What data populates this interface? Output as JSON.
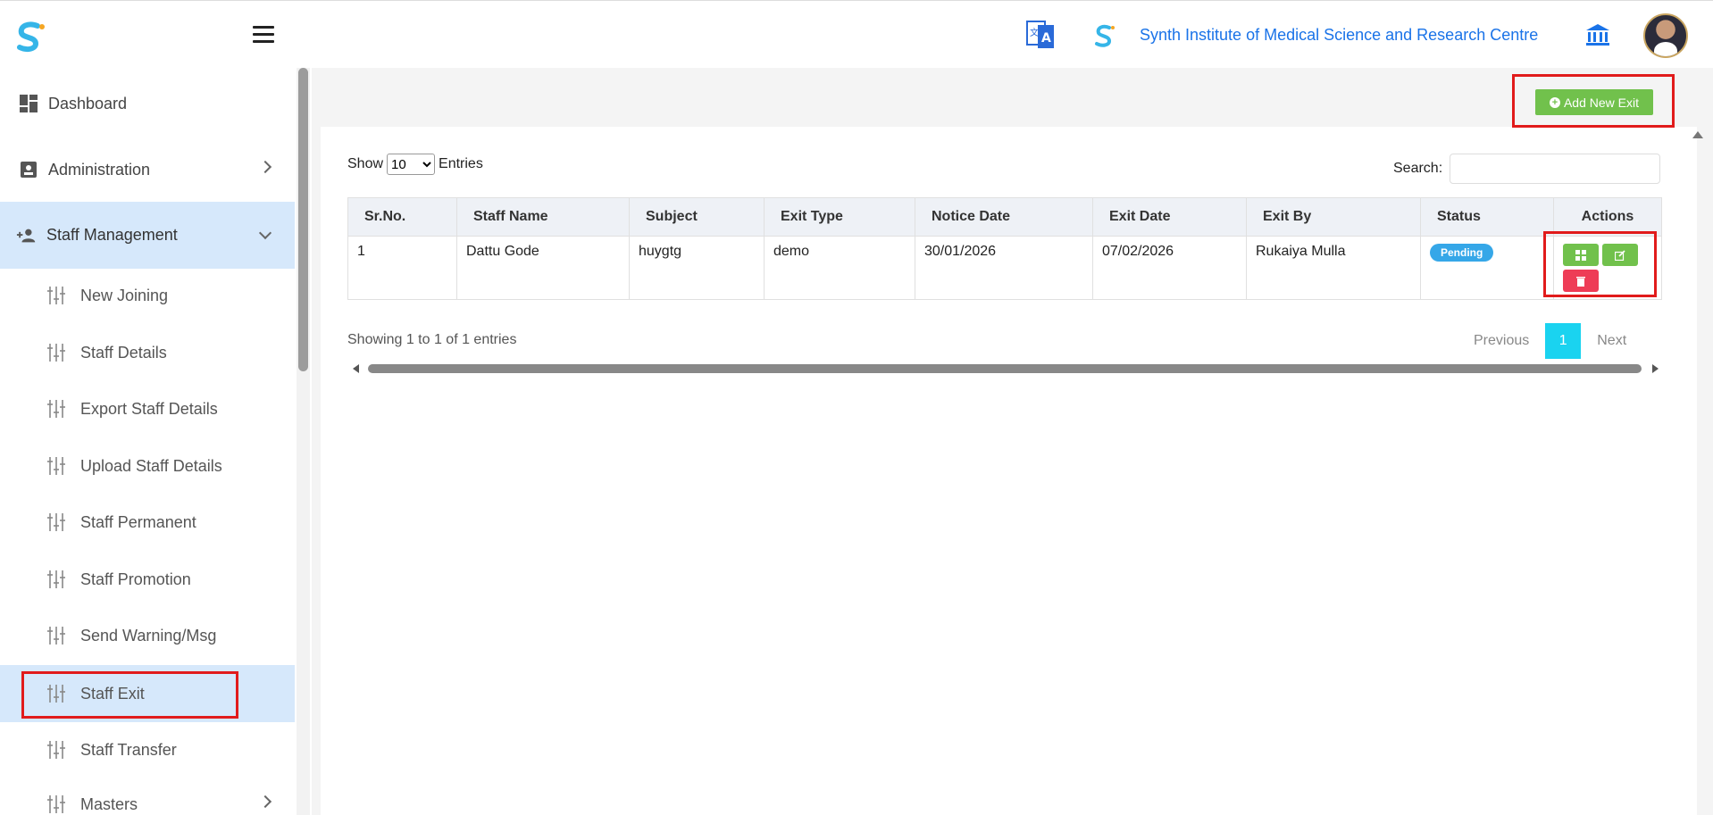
{
  "header": {
    "institute_name": "Synth Institute of Medical Science and Research Centre",
    "icons": [
      "logo-icon",
      "hamburger-icon",
      "translate-icon",
      "institute-logo-icon",
      "bank-icon",
      "avatar"
    ]
  },
  "sidebar": {
    "items": [
      {
        "label": "Dashboard",
        "icon": "dashboard-icon"
      },
      {
        "label": "Administration",
        "icon": "contact-card-icon"
      },
      {
        "label": "Staff Management",
        "icon": "users-add-icon"
      }
    ],
    "sub_items": [
      {
        "label": "New Joining"
      },
      {
        "label": "Staff Details"
      },
      {
        "label": "Export Staff Details"
      },
      {
        "label": "Upload Staff Details"
      },
      {
        "label": "Staff Permanent"
      },
      {
        "label": "Staff Promotion"
      },
      {
        "label": "Send Warning/Msg"
      },
      {
        "label": "Staff Exit"
      },
      {
        "label": "Staff Transfer"
      },
      {
        "label": "Masters"
      }
    ],
    "accent": "#d6e8fb"
  },
  "toolbar": {
    "add_label": "Add New Exit",
    "add_color": "#71c14c"
  },
  "table_controls": {
    "show_label": "Show",
    "entries_label": "Entries",
    "entries_value": "10",
    "search_label": "Search:"
  },
  "table": {
    "headers": [
      "Sr.No.",
      "Staff Name",
      "Subject",
      "Exit Type",
      "Notice Date",
      "Exit Date",
      "Exit By",
      "Status",
      "Actions"
    ],
    "rows": [
      {
        "sr_no": "1",
        "staff_name": "Dattu Gode",
        "subject": "huygtg",
        "exit_type": "demo",
        "notice_date": "30/01/2026",
        "exit_date": "07/02/2026",
        "exit_by": "Rukaiya Mulla",
        "status": "Pending"
      }
    ]
  },
  "footer": {
    "showing_text": "Showing 1 to 1 of 1 entries",
    "previous": "Previous",
    "page": "1",
    "next": "Next"
  },
  "colors": {
    "brand_blue": "#1a73e8",
    "status_badge": "#35a7e8",
    "delete_red": "#ee3c56",
    "highlight_red": "#e11b1b"
  }
}
